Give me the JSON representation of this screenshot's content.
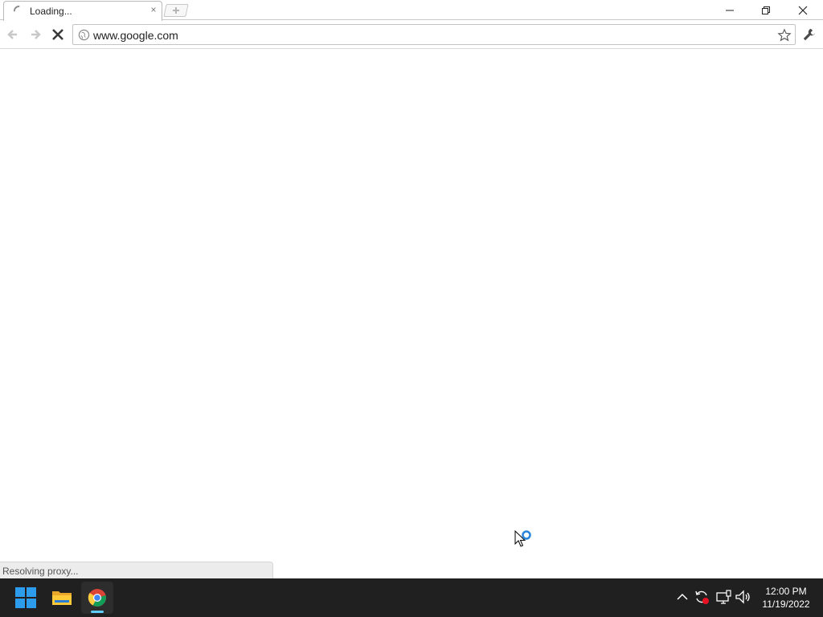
{
  "browser": {
    "tab": {
      "title": "Loading...",
      "close_glyph": "×"
    },
    "new_tab_icon": "plus-icon",
    "window_controls": [
      "minimize-icon",
      "restore-icon",
      "close-icon"
    ],
    "toolbar": {
      "back_icon": "back-arrow-icon",
      "forward_icon": "forward-arrow-icon",
      "stop_icon": "stop-icon",
      "url": "www.google.com",
      "bookmark_icon": "star-icon",
      "menu_icon": "wrench-icon"
    },
    "status_text": "Resolving proxy..."
  },
  "taskbar": {
    "apps": [
      {
        "name": "Start",
        "icon": "windows-logo-icon",
        "active": false
      },
      {
        "name": "File Explorer",
        "icon": "folder-icon",
        "active": false
      },
      {
        "name": "Chrome",
        "icon": "chrome-icon",
        "active": true
      }
    ],
    "tray_icons": [
      "chevron-up-icon",
      "sync-icon",
      "network-icon",
      "volume-icon"
    ],
    "time": "12:00 PM",
    "date": "11/19/2022"
  },
  "colors": {
    "taskbar_bg": "#202020",
    "accent": "#60cdff",
    "windows_blue": "#2d9cec"
  }
}
